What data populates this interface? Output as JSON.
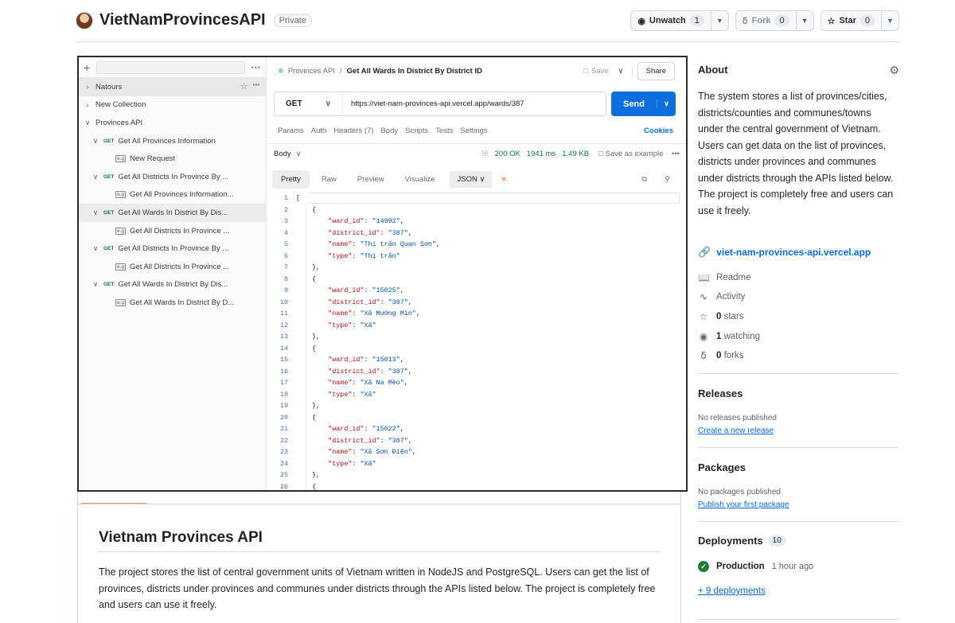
{
  "repo": {
    "name": "VietNamProvincesAPI",
    "visibility": "Private",
    "unwatch_label": "Unwatch",
    "watch_count": "1",
    "fork_label": "Fork",
    "fork_count": "0",
    "star_label": "Star",
    "star_count": "0"
  },
  "postman": {
    "sidebar": {
      "items": [
        {
          "label": "Natours",
          "chevron": ">",
          "level": 0
        },
        {
          "label": "New Collection",
          "chevron": ">",
          "level": 0
        },
        {
          "label": "Provinces API",
          "chevron": "v",
          "level": 0
        },
        {
          "label": "Get All Provinces Information",
          "method": "GET",
          "level": 1
        },
        {
          "label": "New Request",
          "example": true,
          "level": 2
        },
        {
          "label": "Get All Districts In Province By ...",
          "method": "GET",
          "level": 1
        },
        {
          "label": "Get All Provinces Information...",
          "example": true,
          "level": 2
        },
        {
          "label": "Get All Wards In District By Dis...",
          "method": "GET",
          "level": 1,
          "selected": true
        },
        {
          "label": "Get All Districts In Province ...",
          "example": true,
          "level": 2
        },
        {
          "label": "Get All Districts In Province By ...",
          "method": "GET",
          "level": 1
        },
        {
          "label": "Get All Districts In Province ...",
          "example": true,
          "level": 2
        },
        {
          "label": "Get All Wards In District By Dis...",
          "method": "GET",
          "level": 1
        },
        {
          "label": "Get All Wards In District By D...",
          "example": true,
          "level": 2
        }
      ]
    },
    "tab": {
      "breadcrumb": "Provinces API",
      "separator": "/",
      "title": "Get All Wards In District By District ID",
      "save_label": "Save",
      "share_label": "Share"
    },
    "request": {
      "method": "GET",
      "url": "https://viet-nam-provinces-api.vercel.app/wards/387",
      "send_label": "Send",
      "tabs": [
        "Params",
        "Auth",
        "Headers (7)",
        "Body",
        "Scripts",
        "Tests",
        "Settings"
      ],
      "cookies_label": "Cookies"
    },
    "response": {
      "body_label": "Body",
      "status": "200 OK",
      "time": "1941 ms",
      "size": "1.49 KB",
      "save_example_label": "Save as example",
      "view_tabs": [
        "Pretty",
        "Raw",
        "Preview",
        "Visualize"
      ],
      "format": "JSON",
      "lines": [
        {
          "n": "1",
          "t": "["
        },
        {
          "n": "2",
          "t": "    {"
        },
        {
          "n": "3",
          "t": "        \"ward_id\": \"14992\","
        },
        {
          "n": "4",
          "t": "        \"district_id\": \"387\","
        },
        {
          "n": "5",
          "t": "        \"name\": \"Thị trấn Quan Sơn\","
        },
        {
          "n": "6",
          "t": "        \"type\": \"Thị trấn\""
        },
        {
          "n": "7",
          "t": "    },"
        },
        {
          "n": "8",
          "t": "    {"
        },
        {
          "n": "9",
          "t": "        \"ward_id\": \"15025\","
        },
        {
          "n": "10",
          "t": "        \"district_id\": \"387\","
        },
        {
          "n": "11",
          "t": "        \"name\": \"Xã Mường Mìn\","
        },
        {
          "n": "12",
          "t": "        \"type\": \"Xã\""
        },
        {
          "n": "13",
          "t": "    },"
        },
        {
          "n": "14",
          "t": "    {"
        },
        {
          "n": "15",
          "t": "        \"ward_id\": \"15013\","
        },
        {
          "n": "16",
          "t": "        \"district_id\": \"387\","
        },
        {
          "n": "17",
          "t": "        \"name\": \"Xã Na Mèo\","
        },
        {
          "n": "18",
          "t": "        \"type\": \"Xã\""
        },
        {
          "n": "19",
          "t": "    },"
        },
        {
          "n": "20",
          "t": "    {"
        },
        {
          "n": "21",
          "t": "        \"ward_id\": \"15022\","
        },
        {
          "n": "22",
          "t": "        \"district_id\": \"387\","
        },
        {
          "n": "23",
          "t": "        \"name\": \"Xã Sơn Điện\","
        },
        {
          "n": "24",
          "t": "        \"type\": \"Xã\""
        },
        {
          "n": "25",
          "t": "    },"
        },
        {
          "n": "26",
          "t": "    {"
        }
      ]
    }
  },
  "readme": {
    "heading": "Vietnam Provinces API",
    "paragraph": "The project stores the list of central government units of Vietnam written in NodeJS and PostgreSQL. Users can get the list of provinces, districts under provinces and communes under districts through the APIs listed below. The project is completely free and users can use it freely."
  },
  "about": {
    "heading": "About",
    "description": "The system stores a list of provinces/cities, districts/counties and communes/towns under the central government of Vietnam. Users can get data on the list of provinces, districts under provinces and communes under districts through the APIs listed below. The project is completely free and users can use it freely.",
    "homepage": "viet-nam-provinces-api.vercel.app",
    "readme_label": "Readme",
    "activity_label": "Activity",
    "stars_count": "0",
    "stars_label": "stars",
    "watching_count": "1",
    "watching_label": "watching",
    "forks_count": "0",
    "forks_label": "forks"
  },
  "releases": {
    "heading": "Releases",
    "empty": "No releases published",
    "link": "Create a new release"
  },
  "packages": {
    "heading": "Packages",
    "empty": "No packages published",
    "link": "Publish your first package"
  },
  "deployments": {
    "heading": "Deployments",
    "count": "10",
    "env": "Production",
    "ago": "1 hour ago",
    "more_link": "+ 9 deployments"
  }
}
